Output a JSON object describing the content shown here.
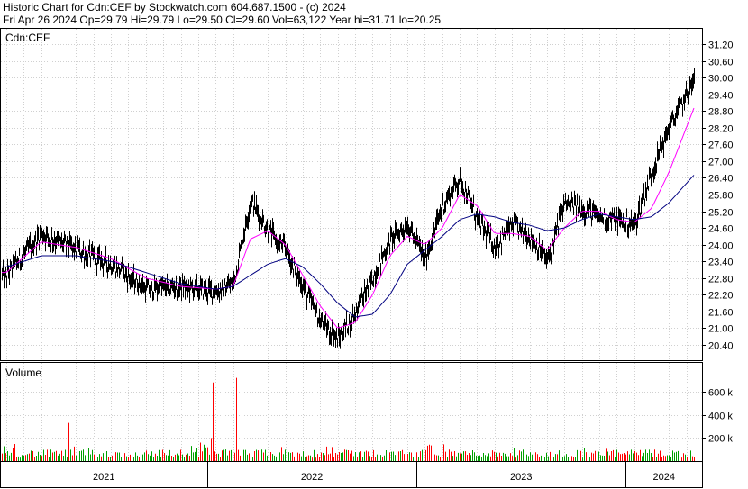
{
  "header": {
    "line1": "Historic Chart for Cdn:CEF by Stockwatch.com 604.687.1500 - (c) 2024",
    "line2": "Fri Apr 26 2024  Op=29.79  Hi=29.79  Lo=29.50  Cl=29.60  Vol=63,122  Year hi=31.71  lo=20.25"
  },
  "chart_data": [
    {
      "type": "line",
      "panel_label": "Cdn:CEF",
      "style": "daily high-low bars with moving averages",
      "y_ticks": [
        "31.20",
        "30.60",
        "30.00",
        "29.40",
        "28.80",
        "28.20",
        "27.60",
        "27.00",
        "26.40",
        "25.80",
        "25.20",
        "24.60",
        "24.00",
        "23.40",
        "22.80",
        "22.20",
        "21.60",
        "21.00",
        "20.40"
      ],
      "ylim": [
        19.85,
        31.75
      ],
      "x": [
        "2021-01",
        "2021-03",
        "2021-05",
        "2021-07",
        "2021-09",
        "2021-11",
        "2022-01",
        "2022-02",
        "2022-03",
        "2022-04",
        "2022-05",
        "2022-06",
        "2022-07",
        "2022-08",
        "2022-09",
        "2022-10",
        "2022-11",
        "2022-12",
        "2023-01",
        "2023-02",
        "2023-03",
        "2023-04",
        "2023-05",
        "2023-06",
        "2023-07",
        "2023-08",
        "2023-09",
        "2023-10",
        "2023-11",
        "2023-12",
        "2024-01",
        "2024-02",
        "2024-03",
        "2024-04"
      ],
      "series": [
        {
          "name": "",
          "color": "#000000",
          "values": [
            22.9,
            24.4,
            23.8,
            23.3,
            22.4,
            22.5,
            22.3,
            22.6,
            25.6,
            24.5,
            23.8,
            22.5,
            21.2,
            20.6,
            21.6,
            22.8,
            24.2,
            24.7,
            23.5,
            25.4,
            26.4,
            24.9,
            23.9,
            24.7,
            24.3,
            23.4,
            25.5,
            25.3,
            25.0,
            24.9,
            24.7,
            26.6,
            28.2,
            29.9
          ]
        },
        {
          "name": "",
          "color": "#ff00ff",
          "values": [
            23.0,
            24.1,
            23.9,
            23.5,
            22.8,
            22.5,
            22.4,
            22.5,
            24.2,
            24.5,
            24.0,
            22.9,
            21.8,
            21.0,
            21.2,
            22.2,
            23.6,
            24.3,
            24.0,
            24.6,
            25.8,
            25.4,
            24.4,
            24.4,
            24.3,
            23.8,
            24.6,
            25.2,
            25.2,
            24.9,
            24.8,
            25.3,
            26.6,
            28.9
          ]
        },
        {
          "name": "",
          "color": "#000080",
          "values": [
            23.2,
            23.6,
            23.6,
            23.4,
            23.0,
            22.6,
            22.4,
            22.5,
            22.9,
            23.3,
            23.5,
            23.2,
            22.6,
            21.9,
            21.4,
            21.5,
            22.2,
            23.3,
            23.8,
            24.3,
            24.9,
            25.1,
            25.0,
            24.8,
            24.7,
            24.5,
            24.6,
            24.9,
            25.1,
            25.0,
            24.9,
            25.0,
            25.5,
            26.5
          ]
        }
      ]
    },
    {
      "type": "bar",
      "panel_label": "Volume",
      "y_ticks": [
        "600 k",
        "400 k",
        "200 k"
      ],
      "ylim": [
        0,
        850000
      ],
      "x_ticks": [
        "2021",
        "2022",
        "2023",
        "2024"
      ],
      "annotations": [
        "spikes to ~680k and ~720k in early 2022; ~330k in mid 2021"
      ]
    }
  ]
}
